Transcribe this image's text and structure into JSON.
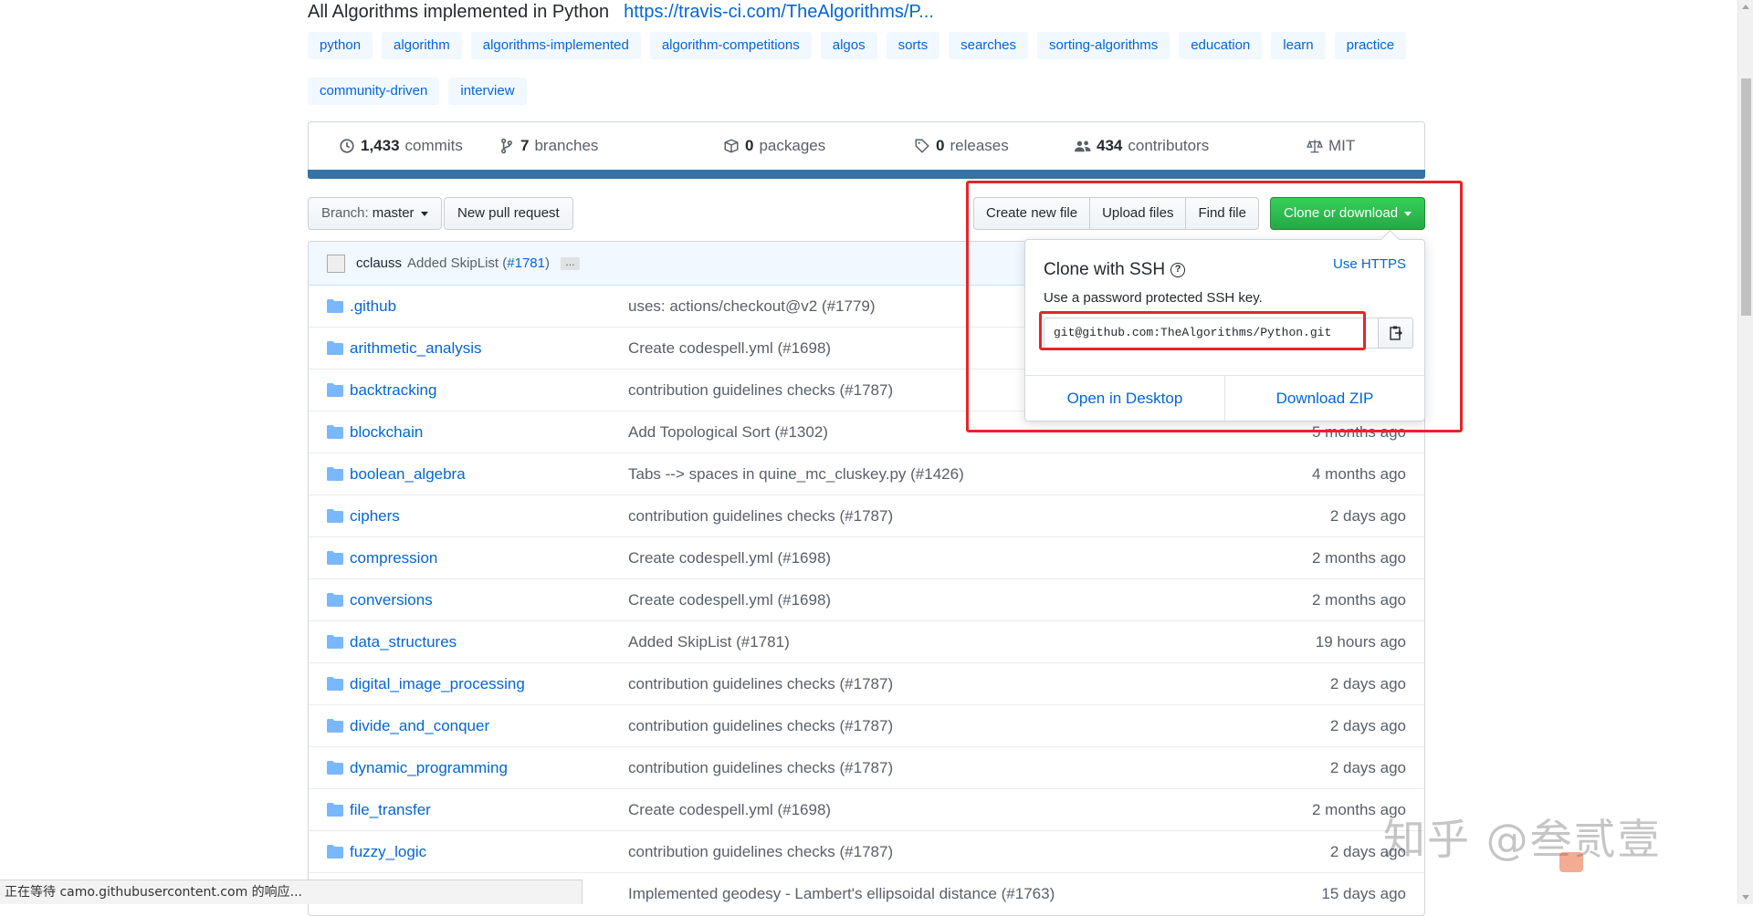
{
  "repo": {
    "description": "All Algorithms implemented in Python",
    "website": "https://travis-ci.com/TheAlgorithms/P...",
    "topics": [
      "python",
      "algorithm",
      "algorithms-implemented",
      "algorithm-competitions",
      "algos",
      "sorts",
      "searches",
      "sorting-algorithms",
      "education",
      "learn",
      "practice",
      "community-driven",
      "interview"
    ]
  },
  "summary": {
    "commits_count": "1,433",
    "commits_label": "commits",
    "branches_count": "7",
    "branches_label": "branches",
    "packages_count": "0",
    "packages_label": "packages",
    "releases_count": "0",
    "releases_label": "releases",
    "contributors_count": "434",
    "contributors_label": "contributors",
    "license": "MIT",
    "language_color": "#3572A5"
  },
  "toolbar": {
    "branch_label": "Branch:",
    "branch_name": "master",
    "new_pull_request": "New pull request",
    "create_new_file": "Create new file",
    "upload_files": "Upload files",
    "find_file": "Find file",
    "clone_or_download": "Clone or download"
  },
  "latest_commit": {
    "author": "cclauss",
    "message": "Added SkipList (",
    "pr": "#1781",
    "message_end": ")",
    "ellipsis": "…"
  },
  "files": [
    {
      "name": ".github",
      "message": "uses: actions/checkout@v2 (#1779)",
      "age": ""
    },
    {
      "name": "arithmetic_analysis",
      "message": "Create codespell.yml (#1698)",
      "age": ""
    },
    {
      "name": "backtracking",
      "message": "contribution guidelines checks (#1787)",
      "age": ""
    },
    {
      "name": "blockchain",
      "message": "Add Topological Sort (#1302)",
      "age": "5 months ago"
    },
    {
      "name": "boolean_algebra",
      "message": "Tabs --> spaces in quine_mc_cluskey.py (#1426)",
      "age": "4 months ago"
    },
    {
      "name": "ciphers",
      "message": "contribution guidelines checks (#1787)",
      "age": "2 days ago"
    },
    {
      "name": "compression",
      "message": "Create codespell.yml (#1698)",
      "age": "2 months ago"
    },
    {
      "name": "conversions",
      "message": "Create codespell.yml (#1698)",
      "age": "2 months ago"
    },
    {
      "name": "data_structures",
      "message": "Added SkipList (#1781)",
      "age": "19 hours ago"
    },
    {
      "name": "digital_image_processing",
      "message": "contribution guidelines checks (#1787)",
      "age": "2 days ago"
    },
    {
      "name": "divide_and_conquer",
      "message": "contribution guidelines checks (#1787)",
      "age": "2 days ago"
    },
    {
      "name": "dynamic_programming",
      "message": "contribution guidelines checks (#1787)",
      "age": "2 days ago"
    },
    {
      "name": "file_transfer",
      "message": "Create codespell.yml (#1698)",
      "age": "2 months ago"
    },
    {
      "name": "fuzzy_logic",
      "message": "contribution guidelines checks (#1787)",
      "age": "2 days ago"
    },
    {
      "name": "",
      "message": "Implemented geodesy - Lambert's ellipsoidal distance (#1763)",
      "age": "15 days ago"
    }
  ],
  "clone_popup": {
    "title": "Clone with SSH",
    "use_https": "Use HTTPS",
    "description": "Use a password protected SSH key.",
    "url": "git@github.com:TheAlgorithms/Python.git",
    "open_desktop": "Open in Desktop",
    "download_zip": "Download ZIP"
  },
  "status_bar": "正在等待 camo.githubusercontent.com 的响应...",
  "watermark": "知乎 @叁贰壹",
  "colors": {
    "annotation": "#e5252a",
    "link": "#0366d6",
    "clone_button": "#28a745"
  }
}
